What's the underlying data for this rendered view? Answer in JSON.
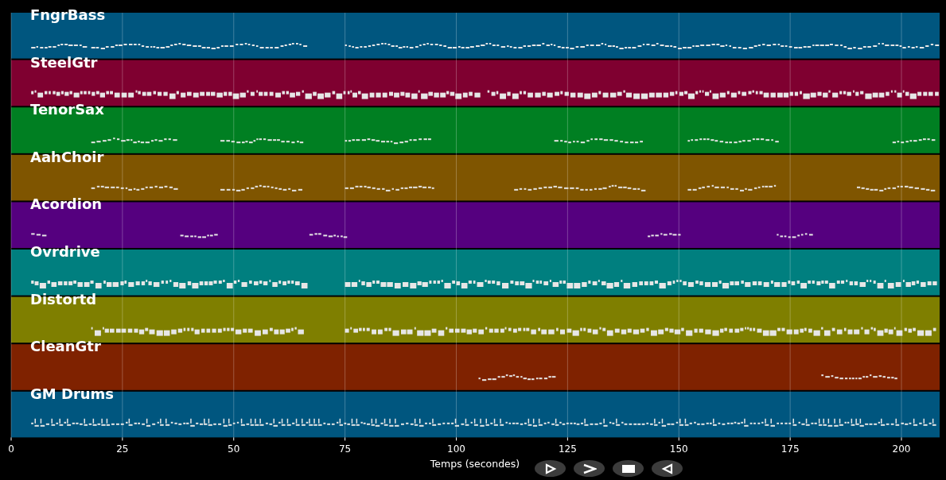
{
  "tracks": [
    {
      "name": "FngrBass",
      "color": "#00567f"
    },
    {
      "name": "SteelGtr",
      "color": "#7f0030"
    },
    {
      "name": "TenorSax",
      "color": "#007f22"
    },
    {
      "name": "AahChoir",
      "color": "#7f5500"
    },
    {
      "name": "Acordion",
      "color": "#55007f"
    },
    {
      "name": "Ovrdrive",
      "color": "#007f7f"
    },
    {
      "name": "Distortd",
      "color": "#7f7f00"
    },
    {
      "name": "CleanGtr",
      "color": "#7f2200"
    },
    {
      "name": "GM Drums",
      "color": "#00567f"
    }
  ],
  "x_axis": {
    "ticks": [
      "0",
      "25",
      "50",
      "75",
      "100",
      "125",
      "150",
      "175",
      "200"
    ],
    "title": "Temps (secondes)"
  },
  "controls": [
    {
      "kind": "play"
    },
    {
      "kind": "forward"
    },
    {
      "kind": "stop"
    },
    {
      "kind": "back"
    }
  ]
}
